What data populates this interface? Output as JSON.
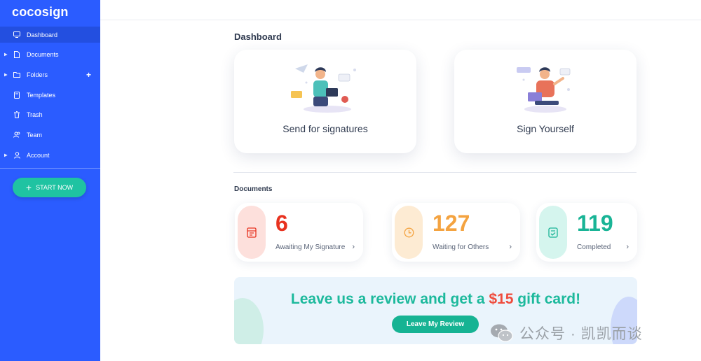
{
  "app": {
    "logo": "cocosign"
  },
  "sidebar": {
    "items": [
      {
        "label": "Dashboard",
        "icon": "monitor-icon"
      },
      {
        "label": "Documents",
        "icon": "file-icon"
      },
      {
        "label": "Folders",
        "icon": "folder-icon"
      },
      {
        "label": "Templates",
        "icon": "template-icon"
      },
      {
        "label": "Trash",
        "icon": "trash-icon"
      },
      {
        "label": "Team",
        "icon": "team-icon"
      },
      {
        "label": "Account",
        "icon": "user-icon"
      }
    ],
    "start_button": "START NOW"
  },
  "dashboard": {
    "title": "Dashboard",
    "cards": [
      {
        "label": "Send for signatures"
      },
      {
        "label": "Sign Yourself"
      }
    ]
  },
  "documents": {
    "title": "Documents",
    "stats": [
      {
        "value": "6",
        "label": "Awaiting My Signature",
        "color": "#e8321f",
        "pill": "#fde0dc"
      },
      {
        "value": "127",
        "label": "Waiting for Others",
        "color": "#f4a340",
        "pill": "#fdebd3"
      },
      {
        "value": "119",
        "label": "Completed",
        "color": "#19b496",
        "pill": "#d5f5ee"
      }
    ]
  },
  "banner": {
    "text_before": "Leave us a review and get a ",
    "amount": "$15",
    "text_after": " gift card!",
    "button": "Leave My Review"
  },
  "watermark": {
    "text": "公众号 · 凯凯而谈"
  },
  "colors": {
    "sidebar": "#2b5cff",
    "accent_green": "#1fc3a2",
    "red": "#e8321f",
    "orange": "#f4a340",
    "teal": "#19b496"
  }
}
